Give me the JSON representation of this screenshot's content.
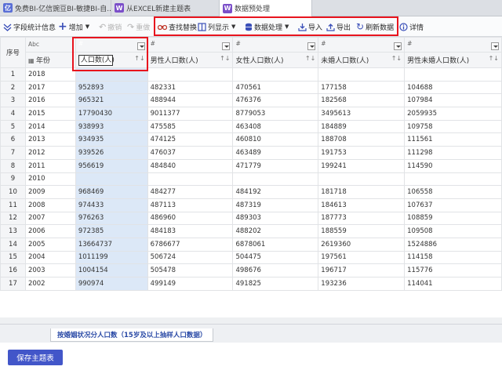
{
  "tabs": [
    {
      "label": "免费BI-亿信豌豆BI-敏捷BI-自...",
      "icon": "yixin-logo-icon",
      "color": "#5a6fd6",
      "glyph": "亿"
    },
    {
      "label": "从EXCEL新建主题表",
      "icon": "wandou-logo-icon",
      "color": "#7b4fc9",
      "glyph": "W"
    },
    {
      "label": "数据预处理",
      "icon": "wandou-logo-icon",
      "color": "#7b4fc9",
      "glyph": "W"
    }
  ],
  "toolbar": {
    "field_stats": "字段统计信息",
    "add": "增加",
    "undo": "撤销",
    "redo": "重做",
    "find_replace": "查找替换",
    "column_display": "列显示",
    "data_processing": "数据处理",
    "import": "导入",
    "export": "导出",
    "refresh": "刷新数据",
    "details": "详情"
  },
  "grid": {
    "rownum_header": "序号",
    "columns": [
      {
        "type": "Abc",
        "name": "年份",
        "has_filter": false
      },
      {
        "type": "#",
        "name": "人口数(人)",
        "has_filter": true,
        "selected": true,
        "editing": true
      },
      {
        "type": "#",
        "name": "男性人口数(人)",
        "has_filter": true
      },
      {
        "type": "#",
        "name": "女性人口数(人)",
        "has_filter": true
      },
      {
        "type": "#",
        "name": "未婚人口数(人)",
        "has_filter": true
      },
      {
        "type": "#",
        "name": "男性未婚人口数(人)",
        "has_filter": true
      }
    ],
    "rows": [
      [
        "1",
        "2018",
        "",
        "",
        "",
        "",
        ""
      ],
      [
        "2",
        "2017",
        "952893",
        "482331",
        "470561",
        "177158",
        "104688"
      ],
      [
        "3",
        "2016",
        "965321",
        "488944",
        "476376",
        "182568",
        "107984"
      ],
      [
        "4",
        "2015",
        "17790430",
        "9011377",
        "8779053",
        "3495613",
        "2059935"
      ],
      [
        "5",
        "2014",
        "938993",
        "475585",
        "463408",
        "184889",
        "109758"
      ],
      [
        "6",
        "2013",
        "934935",
        "474125",
        "460810",
        "188708",
        "111561"
      ],
      [
        "7",
        "2012",
        "939526",
        "476037",
        "463489",
        "191753",
        "111298"
      ],
      [
        "8",
        "2011",
        "956619",
        "484840",
        "471779",
        "199241",
        "114590"
      ],
      [
        "9",
        "2010",
        "",
        "",
        "",
        "",
        ""
      ],
      [
        "10",
        "2009",
        "968469",
        "484277",
        "484192",
        "181718",
        "106558"
      ],
      [
        "11",
        "2008",
        "974433",
        "487113",
        "487319",
        "184613",
        "107637"
      ],
      [
        "12",
        "2007",
        "976263",
        "486960",
        "489303",
        "187773",
        "108859"
      ],
      [
        "13",
        "2006",
        "972385",
        "484183",
        "488202",
        "188559",
        "109508"
      ],
      [
        "14",
        "2005",
        "13664737",
        "6786677",
        "6878061",
        "2619360",
        "1524886"
      ],
      [
        "15",
        "2004",
        "1011199",
        "506724",
        "504475",
        "197561",
        "114158"
      ],
      [
        "16",
        "2003",
        "1004154",
        "505478",
        "498676",
        "196717",
        "115776"
      ],
      [
        "17",
        "2002",
        "990974",
        "499149",
        "491825",
        "193236",
        "114041"
      ]
    ]
  },
  "sheet_tab": "按婚姻状况分人口数（15岁及以上抽样人口数据）",
  "save_button": "保存主题表",
  "colors": {
    "accent": "#4256c9",
    "highlight": "#e8141e",
    "selection": "#dce8f7"
  }
}
